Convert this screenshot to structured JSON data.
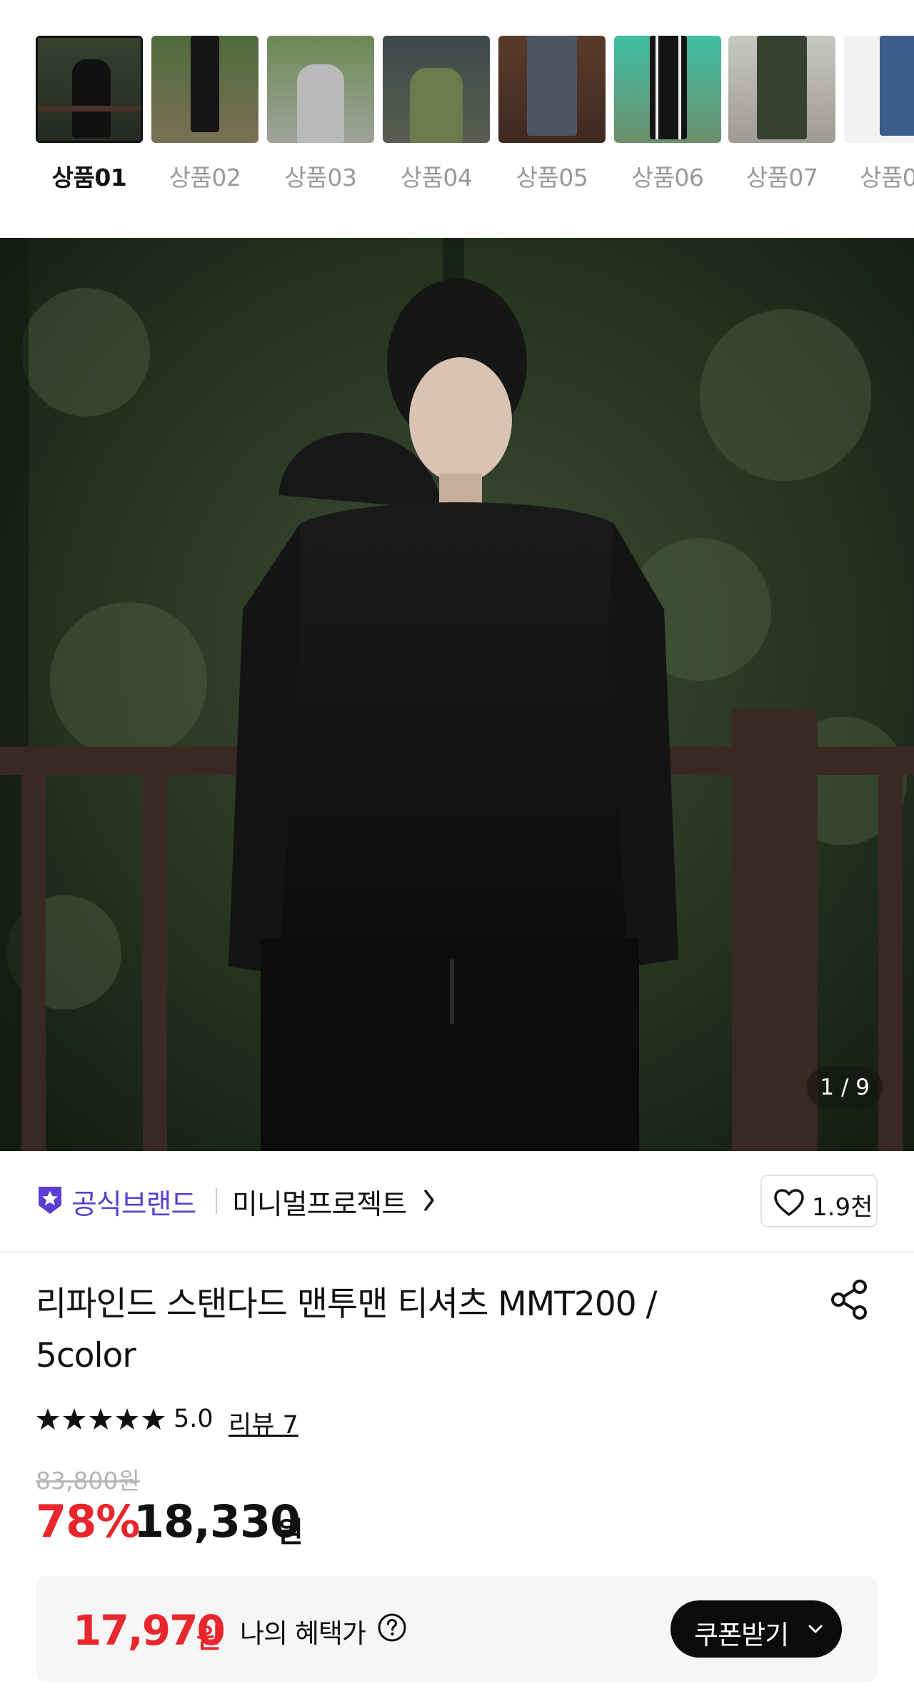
{
  "thumbnails": [
    {
      "label": "상품01",
      "active": true
    },
    {
      "label": "상품02",
      "active": false
    },
    {
      "label": "상품03",
      "active": false
    },
    {
      "label": "상품04",
      "active": false
    },
    {
      "label": "상품05",
      "active": false
    },
    {
      "label": "상품06",
      "active": false
    },
    {
      "label": "상품07",
      "active": false
    },
    {
      "label": "상품0",
      "active": false
    }
  ],
  "gallery": {
    "counter": "1 / 9"
  },
  "brand": {
    "official_label": "공식브랜드",
    "name": "미니멀프로젝트",
    "like_count": "1.9천"
  },
  "product": {
    "title": "리파인드 스탠다드 맨투맨 티셔츠 MMT200 / 5color",
    "rating": "5.0",
    "stars": 5,
    "review_link": "리뷰 7",
    "original_price": "83,800원",
    "discount": "78%",
    "price": "18,330",
    "price_unit": "원"
  },
  "benefit": {
    "price": "17,970",
    "unit": "원",
    "label": "나의 혜택가",
    "coupon_button": "쿠폰받기"
  },
  "colors": {
    "accent_red": "#e8262c",
    "brand_purple": "#5b3fd0"
  }
}
